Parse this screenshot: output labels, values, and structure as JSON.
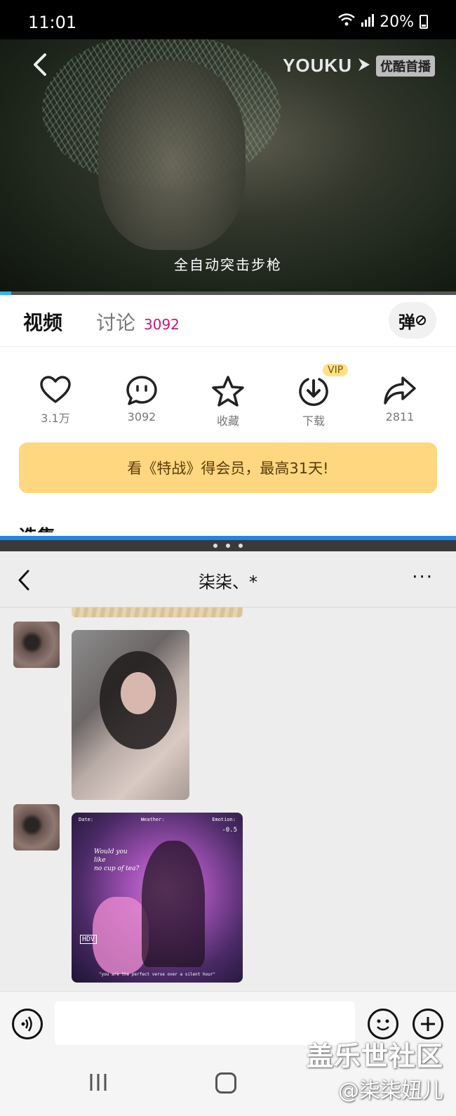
{
  "status_bar": {
    "time": "11:01",
    "battery": "20%"
  },
  "video": {
    "logo_text": "YOUKU",
    "logo_tag": "优酷首播",
    "subtitle": "全自动突击步枪",
    "progress_fraction": 0.025
  },
  "tabs": {
    "video_label": "视频",
    "discuss_label": "讨论",
    "discuss_count": "3092",
    "danmu_label": "弹"
  },
  "actions": [
    {
      "icon": "heart-icon",
      "label": "3.1万"
    },
    {
      "icon": "comment-icon",
      "label": "3092"
    },
    {
      "icon": "star-icon",
      "label": "收藏"
    },
    {
      "icon": "download-icon",
      "label": "下载"
    },
    {
      "icon": "share-icon",
      "label": "2811"
    }
  ],
  "vip_badge": "VIP",
  "promo_text": "看《特战》得会员，最高31天!",
  "section_peek": "选集",
  "chat": {
    "title": "柒柒、*",
    "more": "···",
    "photo2": {
      "meta_date": "Date:",
      "meta_weather": "Weather:",
      "meta_emotion": "Emotion:",
      "ev": "-0.5",
      "quote": "Would you\nlike\nno cup of tea?",
      "hdv": "HDV",
      "caption": "\"you are the perfect verse over a silent hour\""
    }
  },
  "watermark": {
    "line1": "盖乐世社区",
    "line2": "@柒柒妞儿"
  },
  "colors": {
    "accent_blue": "#1e88e5",
    "promo_bg": "#ffd780",
    "count_pink": "#c2187a"
  }
}
